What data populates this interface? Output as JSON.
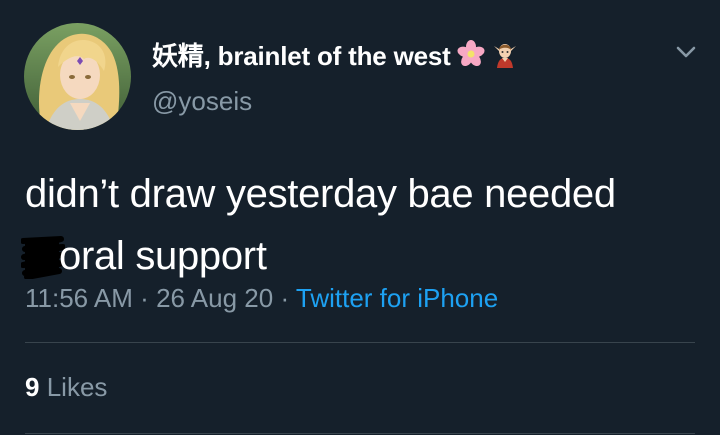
{
  "tweet": {
    "display_name": "妖精, brainlet of the west",
    "name_emojis": [
      "cherry-blossom",
      "elf"
    ],
    "handle": "@yoseis",
    "text_line_1": "didn’t draw yesterday bae needed",
    "text_line_2": "oral support",
    "time": "11:56 AM",
    "separator": "·",
    "date": "26 Aug 20",
    "source": "Twitter for iPhone",
    "likes_count": "9",
    "likes_label": "Likes"
  },
  "colors": {
    "background": "#15202b",
    "primary_text": "#ffffff",
    "secondary_text": "#8899a6",
    "link": "#1da1f2",
    "divider": "#38444d"
  }
}
